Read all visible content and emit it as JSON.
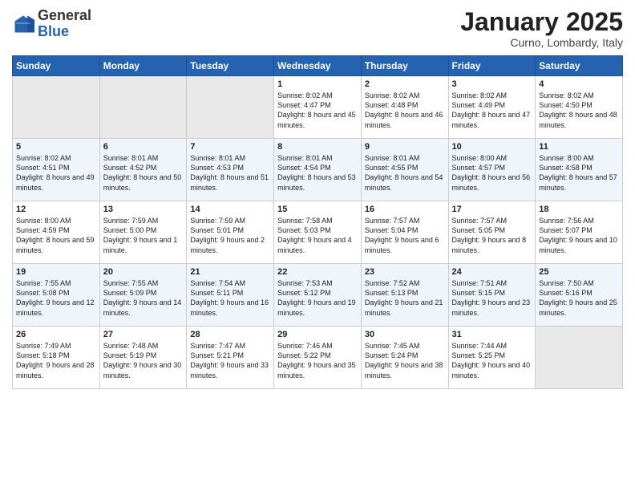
{
  "logo": {
    "general": "General",
    "blue": "Blue"
  },
  "header": {
    "month": "January 2025",
    "location": "Curno, Lombardy, Italy"
  },
  "weekdays": [
    "Sunday",
    "Monday",
    "Tuesday",
    "Wednesday",
    "Thursday",
    "Friday",
    "Saturday"
  ],
  "weeks": [
    [
      {
        "day": "",
        "sunrise": "",
        "sunset": "",
        "daylight": ""
      },
      {
        "day": "",
        "sunrise": "",
        "sunset": "",
        "daylight": ""
      },
      {
        "day": "",
        "sunrise": "",
        "sunset": "",
        "daylight": ""
      },
      {
        "day": "1",
        "sunrise": "Sunrise: 8:02 AM",
        "sunset": "Sunset: 4:47 PM",
        "daylight": "Daylight: 8 hours and 45 minutes."
      },
      {
        "day": "2",
        "sunrise": "Sunrise: 8:02 AM",
        "sunset": "Sunset: 4:48 PM",
        "daylight": "Daylight: 8 hours and 46 minutes."
      },
      {
        "day": "3",
        "sunrise": "Sunrise: 8:02 AM",
        "sunset": "Sunset: 4:49 PM",
        "daylight": "Daylight: 8 hours and 47 minutes."
      },
      {
        "day": "4",
        "sunrise": "Sunrise: 8:02 AM",
        "sunset": "Sunset: 4:50 PM",
        "daylight": "Daylight: 8 hours and 48 minutes."
      }
    ],
    [
      {
        "day": "5",
        "sunrise": "Sunrise: 8:02 AM",
        "sunset": "Sunset: 4:51 PM",
        "daylight": "Daylight: 8 hours and 49 minutes."
      },
      {
        "day": "6",
        "sunrise": "Sunrise: 8:01 AM",
        "sunset": "Sunset: 4:52 PM",
        "daylight": "Daylight: 8 hours and 50 minutes."
      },
      {
        "day": "7",
        "sunrise": "Sunrise: 8:01 AM",
        "sunset": "Sunset: 4:53 PM",
        "daylight": "Daylight: 8 hours and 51 minutes."
      },
      {
        "day": "8",
        "sunrise": "Sunrise: 8:01 AM",
        "sunset": "Sunset: 4:54 PM",
        "daylight": "Daylight: 8 hours and 53 minutes."
      },
      {
        "day": "9",
        "sunrise": "Sunrise: 8:01 AM",
        "sunset": "Sunset: 4:55 PM",
        "daylight": "Daylight: 8 hours and 54 minutes."
      },
      {
        "day": "10",
        "sunrise": "Sunrise: 8:00 AM",
        "sunset": "Sunset: 4:57 PM",
        "daylight": "Daylight: 8 hours and 56 minutes."
      },
      {
        "day": "11",
        "sunrise": "Sunrise: 8:00 AM",
        "sunset": "Sunset: 4:58 PM",
        "daylight": "Daylight: 8 hours and 57 minutes."
      }
    ],
    [
      {
        "day": "12",
        "sunrise": "Sunrise: 8:00 AM",
        "sunset": "Sunset: 4:59 PM",
        "daylight": "Daylight: 8 hours and 59 minutes."
      },
      {
        "day": "13",
        "sunrise": "Sunrise: 7:59 AM",
        "sunset": "Sunset: 5:00 PM",
        "daylight": "Daylight: 9 hours and 1 minute."
      },
      {
        "day": "14",
        "sunrise": "Sunrise: 7:59 AM",
        "sunset": "Sunset: 5:01 PM",
        "daylight": "Daylight: 9 hours and 2 minutes."
      },
      {
        "day": "15",
        "sunrise": "Sunrise: 7:58 AM",
        "sunset": "Sunset: 5:03 PM",
        "daylight": "Daylight: 9 hours and 4 minutes."
      },
      {
        "day": "16",
        "sunrise": "Sunrise: 7:57 AM",
        "sunset": "Sunset: 5:04 PM",
        "daylight": "Daylight: 9 hours and 6 minutes."
      },
      {
        "day": "17",
        "sunrise": "Sunrise: 7:57 AM",
        "sunset": "Sunset: 5:05 PM",
        "daylight": "Daylight: 9 hours and 8 minutes."
      },
      {
        "day": "18",
        "sunrise": "Sunrise: 7:56 AM",
        "sunset": "Sunset: 5:07 PM",
        "daylight": "Daylight: 9 hours and 10 minutes."
      }
    ],
    [
      {
        "day": "19",
        "sunrise": "Sunrise: 7:55 AM",
        "sunset": "Sunset: 5:08 PM",
        "daylight": "Daylight: 9 hours and 12 minutes."
      },
      {
        "day": "20",
        "sunrise": "Sunrise: 7:55 AM",
        "sunset": "Sunset: 5:09 PM",
        "daylight": "Daylight: 9 hours and 14 minutes."
      },
      {
        "day": "21",
        "sunrise": "Sunrise: 7:54 AM",
        "sunset": "Sunset: 5:11 PM",
        "daylight": "Daylight: 9 hours and 16 minutes."
      },
      {
        "day": "22",
        "sunrise": "Sunrise: 7:53 AM",
        "sunset": "Sunset: 5:12 PM",
        "daylight": "Daylight: 9 hours and 19 minutes."
      },
      {
        "day": "23",
        "sunrise": "Sunrise: 7:52 AM",
        "sunset": "Sunset: 5:13 PM",
        "daylight": "Daylight: 9 hours and 21 minutes."
      },
      {
        "day": "24",
        "sunrise": "Sunrise: 7:51 AM",
        "sunset": "Sunset: 5:15 PM",
        "daylight": "Daylight: 9 hours and 23 minutes."
      },
      {
        "day": "25",
        "sunrise": "Sunrise: 7:50 AM",
        "sunset": "Sunset: 5:16 PM",
        "daylight": "Daylight: 9 hours and 25 minutes."
      }
    ],
    [
      {
        "day": "26",
        "sunrise": "Sunrise: 7:49 AM",
        "sunset": "Sunset: 5:18 PM",
        "daylight": "Daylight: 9 hours and 28 minutes."
      },
      {
        "day": "27",
        "sunrise": "Sunrise: 7:48 AM",
        "sunset": "Sunset: 5:19 PM",
        "daylight": "Daylight: 9 hours and 30 minutes."
      },
      {
        "day": "28",
        "sunrise": "Sunrise: 7:47 AM",
        "sunset": "Sunset: 5:21 PM",
        "daylight": "Daylight: 9 hours and 33 minutes."
      },
      {
        "day": "29",
        "sunrise": "Sunrise: 7:46 AM",
        "sunset": "Sunset: 5:22 PM",
        "daylight": "Daylight: 9 hours and 35 minutes."
      },
      {
        "day": "30",
        "sunrise": "Sunrise: 7:45 AM",
        "sunset": "Sunset: 5:24 PM",
        "daylight": "Daylight: 9 hours and 38 minutes."
      },
      {
        "day": "31",
        "sunrise": "Sunrise: 7:44 AM",
        "sunset": "Sunset: 5:25 PM",
        "daylight": "Daylight: 9 hours and 40 minutes."
      },
      {
        "day": "",
        "sunrise": "",
        "sunset": "",
        "daylight": ""
      }
    ]
  ]
}
